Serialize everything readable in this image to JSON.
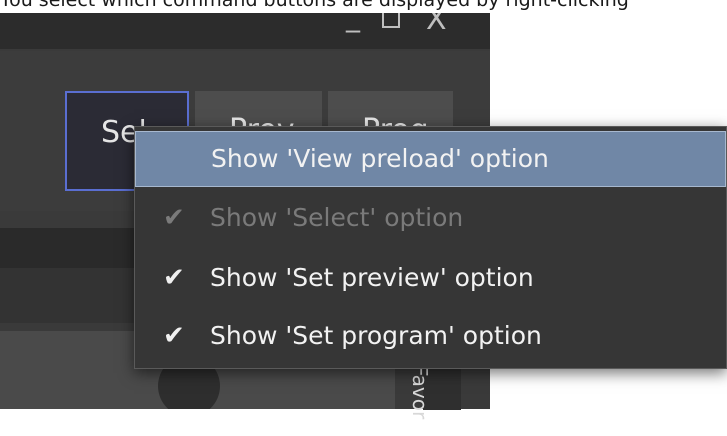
{
  "caption": "You select which command buttons are displayed by right-clicking",
  "window": {
    "controls": {
      "minimize": "_",
      "close": "X"
    }
  },
  "toolbar": {
    "buttons": [
      {
        "label": "Sel"
      },
      {
        "label": "Prev"
      },
      {
        "label": "Prog"
      }
    ]
  },
  "favorites_tab": {
    "label": "Favor"
  },
  "context_menu": {
    "items": [
      {
        "label": "Show 'View preload' option",
        "checked": false,
        "enabled": true,
        "highlighted": true
      },
      {
        "label": "Show 'Select' option",
        "checked": true,
        "enabled": false,
        "highlighted": false,
        "check_glyph": "✔"
      },
      {
        "label": "Show 'Set preview' option",
        "checked": true,
        "enabled": true,
        "highlighted": false,
        "check_glyph": "✔"
      },
      {
        "label": "Show 'Set program' option",
        "checked": true,
        "enabled": true,
        "highlighted": false,
        "check_glyph": "✔"
      }
    ]
  }
}
